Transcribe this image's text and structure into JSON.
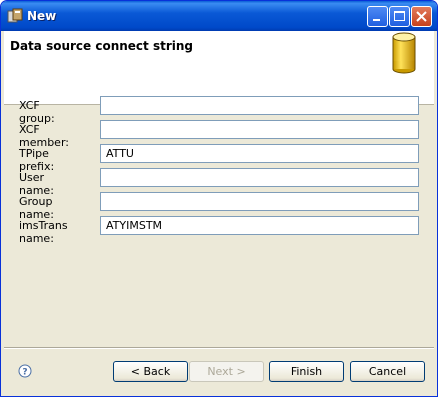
{
  "window": {
    "title": "New"
  },
  "header": {
    "title": "Data source connect string",
    "icon": "database-icon"
  },
  "form": {
    "fields": [
      {
        "label": "XCF group:",
        "value": ""
      },
      {
        "label": "XCF member:",
        "value": ""
      },
      {
        "label": "TPipe prefix:",
        "value": "ATTU"
      },
      {
        "label": "User name:",
        "value": ""
      },
      {
        "label": "Group name:",
        "value": ""
      },
      {
        "label": "imsTrans name:",
        "value": "ATYIMSTM"
      }
    ]
  },
  "buttons": {
    "back": "< Back",
    "next": "Next >",
    "finish": "Finish",
    "cancel": "Cancel"
  },
  "colors": {
    "titlebar": "#0a59d6",
    "dialog_bg": "#ece9d8",
    "input_border": "#7f9db9"
  }
}
